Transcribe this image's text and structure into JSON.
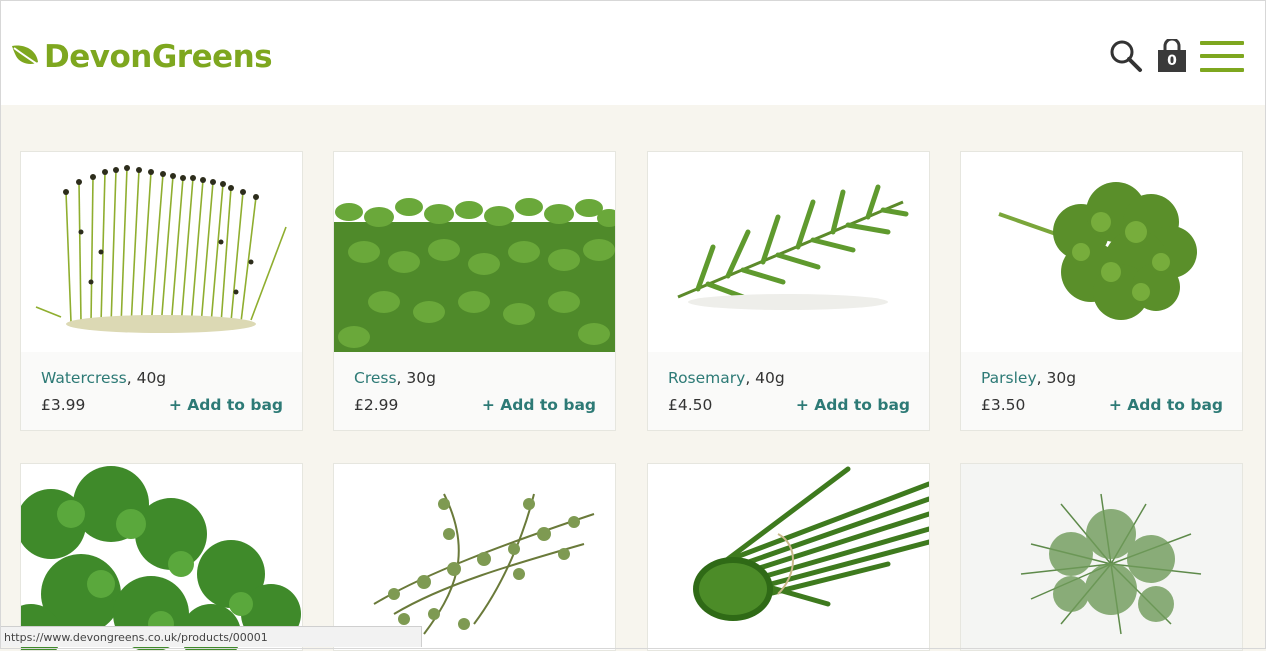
{
  "header": {
    "logo_text": "DevonGreens",
    "bag_count": "0",
    "brand_color": "#7ea71f",
    "icons": [
      "leaf-icon",
      "search-icon",
      "bag-icon",
      "menu-icon"
    ]
  },
  "products": [
    {
      "name": "Watercress",
      "size": ", 40g",
      "price": "£3.99",
      "add_label": "+ Add to bag",
      "image": "watercress"
    },
    {
      "name": "Cress",
      "size": ", 30g",
      "price": "£2.99",
      "add_label": "+ Add to bag",
      "image": "cress"
    },
    {
      "name": "Rosemary",
      "size": ", 40g",
      "price": "£4.50",
      "add_label": "+ Add to bag",
      "image": "rosemary"
    },
    {
      "name": "Parsley",
      "size": ", 30g",
      "price": "£3.50",
      "add_label": "+ Add to bag",
      "image": "parsley"
    },
    {
      "image": "coriander"
    },
    {
      "image": "thyme"
    },
    {
      "image": "chives"
    },
    {
      "image": "dill"
    }
  ],
  "status_bar": {
    "url": "https://www.devongreens.co.uk/products/00001"
  },
  "colors": {
    "product_name": "#2d7a76",
    "page_background": "#f7f5ee"
  }
}
